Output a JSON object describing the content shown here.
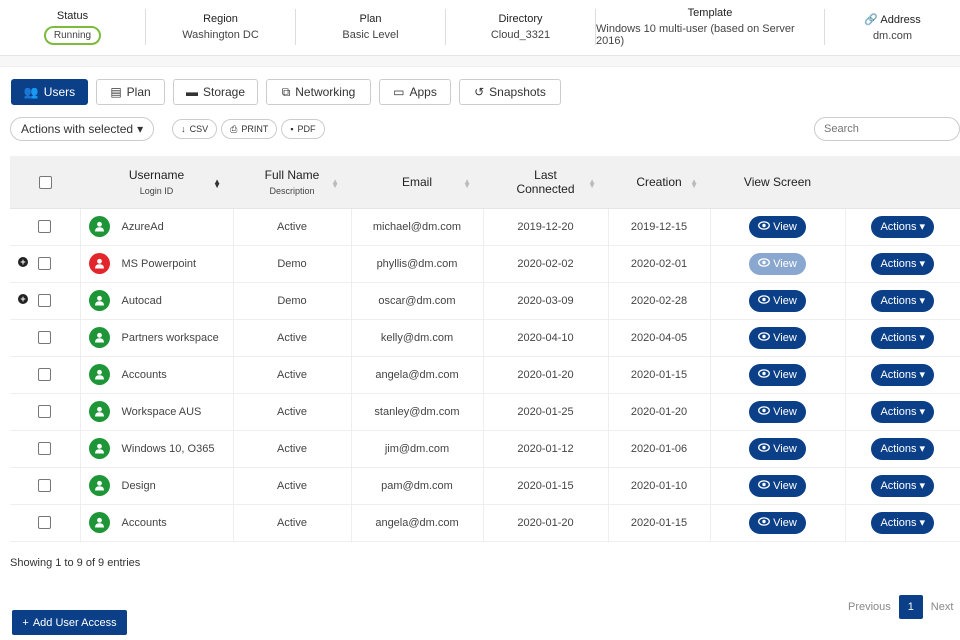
{
  "info": [
    {
      "label": "Status",
      "value": "Running"
    },
    {
      "label": "Region",
      "value": "Washington DC"
    },
    {
      "label": "Plan",
      "value": "Basic Level"
    },
    {
      "label": "Directory",
      "value": "Cloud_3321"
    },
    {
      "label": "Template",
      "value": "Windows 10 multi-user (based on Server 2016)"
    },
    {
      "label": "Address",
      "value": "dm.com"
    }
  ],
  "tabs": [
    "Users",
    "Plan",
    "Storage",
    "Networking",
    "Apps",
    "Snapshots"
  ],
  "toolbar": {
    "actions": "Actions with selected",
    "csv": "CSV",
    "print": "PRINT",
    "pdf": "PDF",
    "search_placeholder": "Search"
  },
  "columns": {
    "username": "Username",
    "login": "Login ID",
    "fullname": "Full Name",
    "description": "Description",
    "email": "Email",
    "last": "Last Connected",
    "creation": "Creation",
    "view": "View Screen"
  },
  "rows": [
    {
      "name": "AzureAd",
      "desc": "Active",
      "email": "michael@dm.com",
      "last": "2019-12-20",
      "created": "2019-12-15",
      "color": "#1e9638",
      "expand": false,
      "view_disabled": false
    },
    {
      "name": "MS Powerpoint",
      "desc": "Demo",
      "email": "phyllis@dm.com",
      "last": "2020-02-02",
      "created": "2020-02-01",
      "color": "#e3262b",
      "expand": true,
      "view_disabled": true
    },
    {
      "name": "Autocad",
      "desc": "Demo",
      "email": "oscar@dm.com",
      "last": "2020-03-09",
      "created": "2020-02-28",
      "color": "#1e9638",
      "expand": true,
      "view_disabled": false
    },
    {
      "name": "Partners workspace",
      "desc": "Active",
      "email": "kelly@dm.com",
      "last": "2020-04-10",
      "created": "2020-04-05",
      "color": "#1e9638",
      "expand": false,
      "view_disabled": false
    },
    {
      "name": "Accounts",
      "desc": "Active",
      "email": "angela@dm.com",
      "last": "2020-01-20",
      "created": "2020-01-15",
      "color": "#1e9638",
      "expand": false,
      "view_disabled": false
    },
    {
      "name": "Workspace AUS",
      "desc": "Active",
      "email": "stanley@dm.com",
      "last": "2020-01-25",
      "created": "2020-01-20",
      "color": "#1e9638",
      "expand": false,
      "view_disabled": false
    },
    {
      "name": "Windows 10, O365",
      "desc": "Active",
      "email": "jim@dm.com",
      "last": "2020-01-12",
      "created": "2020-01-06",
      "color": "#1e9638",
      "expand": false,
      "view_disabled": false
    },
    {
      "name": "Design",
      "desc": "Active",
      "email": "pam@dm.com",
      "last": "2020-01-15",
      "created": "2020-01-10",
      "color": "#1e9638",
      "expand": false,
      "view_disabled": false
    },
    {
      "name": "Accounts",
      "desc": "Active",
      "email": "angela@dm.com",
      "last": "2020-01-20",
      "created": "2020-01-15",
      "color": "#1e9638",
      "expand": false,
      "view_disabled": false
    }
  ],
  "view_label": "View",
  "actions_label": "Actions",
  "footer": {
    "showing": "Showing 1 to 9 of 9 entries",
    "add": "Add User Access",
    "previous": "Previous",
    "page": "1",
    "next": "Next"
  }
}
